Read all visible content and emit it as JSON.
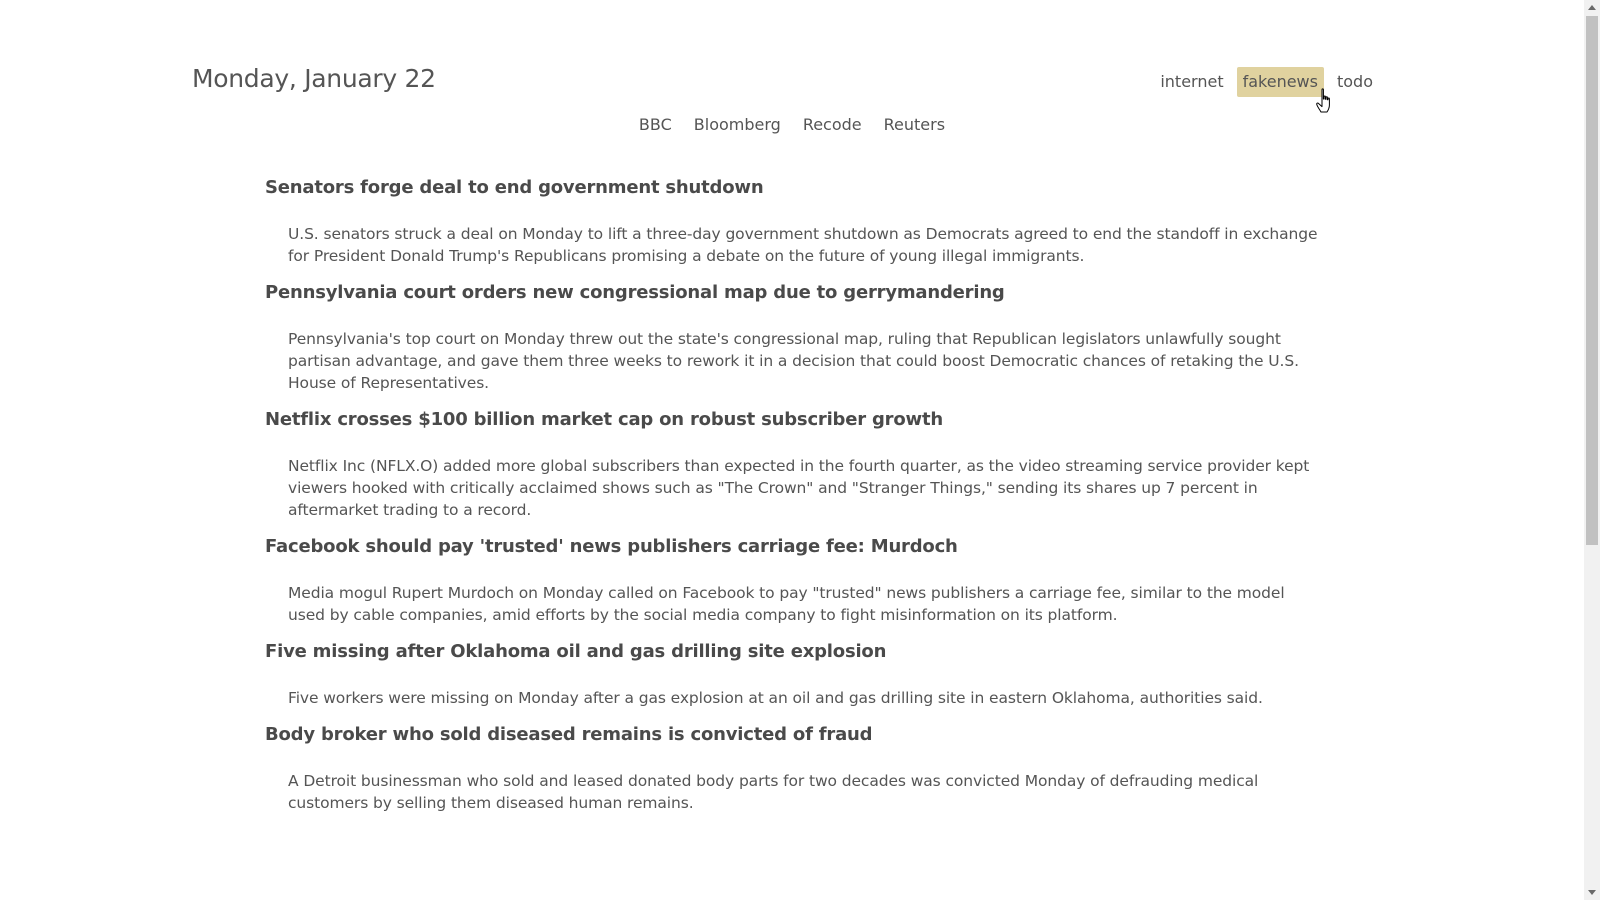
{
  "header": {
    "date": "Monday, January 22",
    "nav": [
      {
        "label": "internet",
        "active": false
      },
      {
        "label": "fakenews",
        "active": true
      },
      {
        "label": "todo",
        "active": false
      }
    ]
  },
  "sources": [
    "BBC",
    "Bloomberg",
    "Recode",
    "Reuters"
  ],
  "articles": [
    {
      "title": "Senators forge deal to end government shutdown",
      "summary": "U.S. senators struck a deal on Monday to lift a three-day government shutdown as Democrats agreed to end the standoff in exchange for President Donald Trump's Republicans promising a debate on the future of young illegal immigrants."
    },
    {
      "title": "Pennsylvania court orders new congressional map due to gerrymandering",
      "summary": "Pennsylvania's top court on Monday threw out the state's congressional map, ruling that Republican legislators unlawfully sought partisan advantage, and gave them three weeks to rework it in a decision that could boost Democratic chances of retaking the U.S. House of Representatives."
    },
    {
      "title": "Netflix crosses $100 billion market cap on robust subscriber growth",
      "summary": "Netflix Inc (NFLX.O) added more global subscribers than expected in the fourth quarter, as the video streaming service provider kept viewers hooked with critically acclaimed shows such as \"The Crown\" and \"Stranger Things,\" sending its shares up 7 percent in aftermarket trading to a record."
    },
    {
      "title": "Facebook should pay 'trusted' news publishers carriage fee: Murdoch",
      "summary": "Media mogul Rupert Murdoch on Monday called on Facebook to pay \"trusted\" news publishers a carriage fee, similar to the model used by cable companies, amid efforts by the social media company to fight misinformation on its platform."
    },
    {
      "title": "Five missing after Oklahoma oil and gas drilling site explosion",
      "summary": "Five workers were missing on Monday after a gas explosion at an oil and gas drilling site in eastern Oklahoma, authorities said."
    },
    {
      "title": "Body broker who sold diseased remains is convicted of fraud",
      "summary": "A Detroit businessman who sold and leased donated body parts for two decades was convicted Monday of defrauding medical customers by selling them diseased human remains."
    }
  ],
  "colors": {
    "active_nav_bg": "#e0d29f",
    "text": "#555555"
  }
}
